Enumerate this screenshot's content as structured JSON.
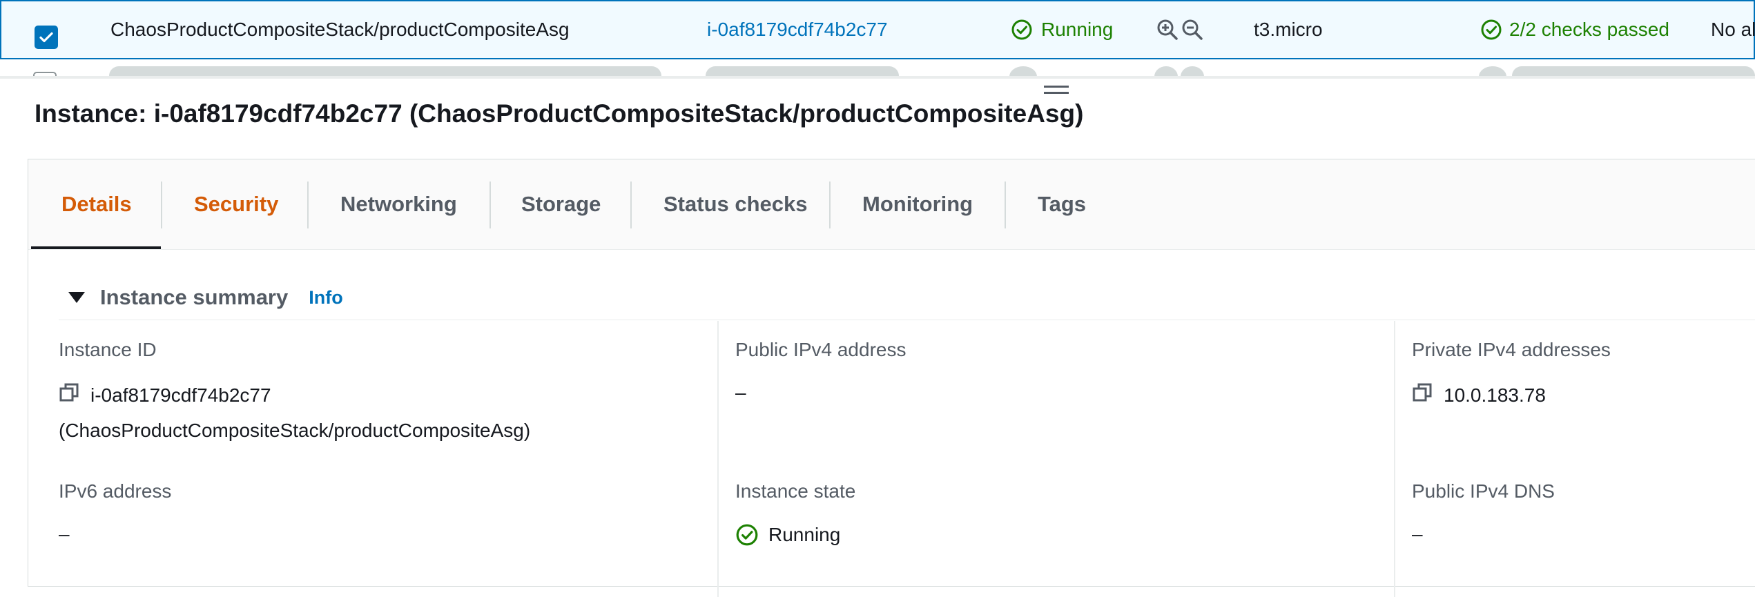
{
  "row": {
    "name": "ChaosProductCompositeStack/productCompositeAsg",
    "instance_id": "i-0af8179cdf74b2c77",
    "state": "Running",
    "type": "t3.micro",
    "checks": "2/2 checks passed",
    "alarm": "No al"
  },
  "instance_title": "Instance: i-0af8179cdf74b2c77 (ChaosProductCompositeStack/productCompositeAsg)",
  "tabs": [
    {
      "label": "Details"
    },
    {
      "label": "Security"
    },
    {
      "label": "Networking"
    },
    {
      "label": "Storage"
    },
    {
      "label": "Status checks"
    },
    {
      "label": "Monitoring"
    },
    {
      "label": "Tags"
    }
  ],
  "section": {
    "title": "Instance summary",
    "info": "Info"
  },
  "fields": {
    "instance_id": {
      "label": "Instance ID",
      "value": "i-0af8179cdf74b2c77",
      "value2": "(ChaosProductCompositeStack/productCompositeAsg)"
    },
    "public_ipv4": {
      "label": "Public IPv4 address",
      "value": "–"
    },
    "private_ipv4": {
      "label": "Private IPv4 addresses",
      "value": "10.0.183.78"
    },
    "ipv6": {
      "label": "IPv6 address",
      "value": "–"
    },
    "instance_state": {
      "label": "Instance state",
      "value": "Running"
    },
    "public_dns": {
      "label": "Public IPv4 DNS",
      "value": "–"
    }
  },
  "colors": {
    "link": "#0073bb",
    "success": "#1d8102",
    "tab_active": "#d45b07",
    "selected_row_bg": "#f1faff"
  }
}
